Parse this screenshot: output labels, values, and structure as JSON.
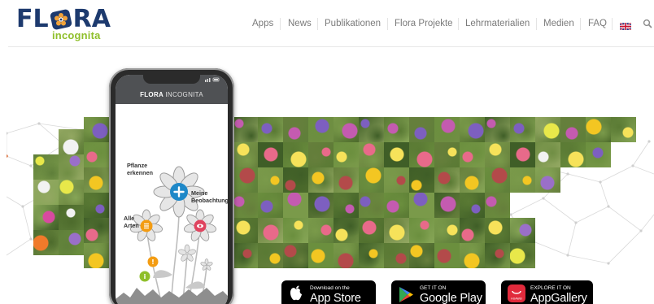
{
  "logo": {
    "name_part1": "FL",
    "name_part2": "RA",
    "tagline": "incognita"
  },
  "nav": {
    "items": [
      "Apps",
      "News",
      "Publikationen",
      "Flora Projekte",
      "Lehrmaterialien",
      "Medien",
      "FAQ"
    ],
    "language_icon": "uk-flag-icon",
    "search_icon": "search-icon"
  },
  "phone": {
    "app_title_bold": "FLORA",
    "app_title_thin": "INCOGNITA",
    "label_identify": [
      "Pflanze",
      "erkennen"
    ],
    "label_observations": [
      "Meine",
      "Beobachtungen"
    ],
    "label_species": [
      "Alle",
      "Arten"
    ]
  },
  "badges": {
    "appstore": {
      "small": "Download on the",
      "big": "App Store"
    },
    "googleplay": {
      "small": "GET IT ON",
      "big": "Google Play"
    },
    "appgallery": {
      "small": "EXPLORE IT ON",
      "big": "AppGallery",
      "brand": "HUAWEI"
    }
  },
  "colors": {
    "navy": "#1d3a6e",
    "green": "#8fbf2a",
    "nav_text": "#7a7a7a",
    "flower_blue": "#1e88c8",
    "flower_orange": "#f39c12",
    "flower_pink": "#e0445f"
  }
}
